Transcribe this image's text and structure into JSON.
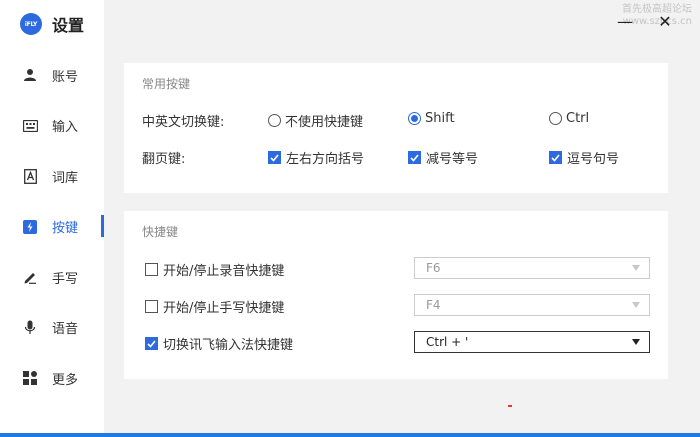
{
  "app": {
    "logo_text": "iFLY",
    "title": "设置"
  },
  "watermark": {
    "line1": "首先极高超论坛",
    "line2": "www.szpcs.cn"
  },
  "window_controls": {
    "minimize": "—",
    "close": "✕"
  },
  "sidebar": {
    "items": [
      {
        "label": "账号",
        "icon": "user-icon",
        "active": false
      },
      {
        "label": "输入",
        "icon": "keyboard-icon",
        "active": false
      },
      {
        "label": "词库",
        "icon": "lexicon-icon",
        "active": false
      },
      {
        "label": "按键",
        "icon": "key-icon",
        "active": true
      },
      {
        "label": "手写",
        "icon": "pen-icon",
        "active": false
      },
      {
        "label": "语音",
        "icon": "microphone-icon",
        "active": false
      },
      {
        "label": "更多",
        "icon": "grid-icon",
        "active": false
      }
    ]
  },
  "common_keys": {
    "title": "常用按键",
    "switch_label": "中英文切换键:",
    "switch_options": [
      {
        "label": "不使用快捷键",
        "selected": false
      },
      {
        "label": "Shift",
        "selected": true
      },
      {
        "label": "Ctrl",
        "selected": false
      }
    ],
    "page_label": "翻页键:",
    "page_options": [
      {
        "label": "左右方向括号",
        "checked": true
      },
      {
        "label": "减号等号",
        "checked": true
      },
      {
        "label": "逗号句号",
        "checked": true
      }
    ]
  },
  "shortcuts": {
    "title": "快捷键",
    "rows": [
      {
        "label": "开始/停止录音快捷键",
        "checked": false,
        "value": "F6"
      },
      {
        "label": "开始/停止手写快捷键",
        "checked": false,
        "value": "F4"
      },
      {
        "label": "切换讯飞输入法快捷键",
        "checked": true,
        "value": "Ctrl + '"
      }
    ]
  },
  "colors": {
    "accent": "#2d6ae0",
    "background": "#f2f2f2",
    "panel": "#ffffff"
  }
}
